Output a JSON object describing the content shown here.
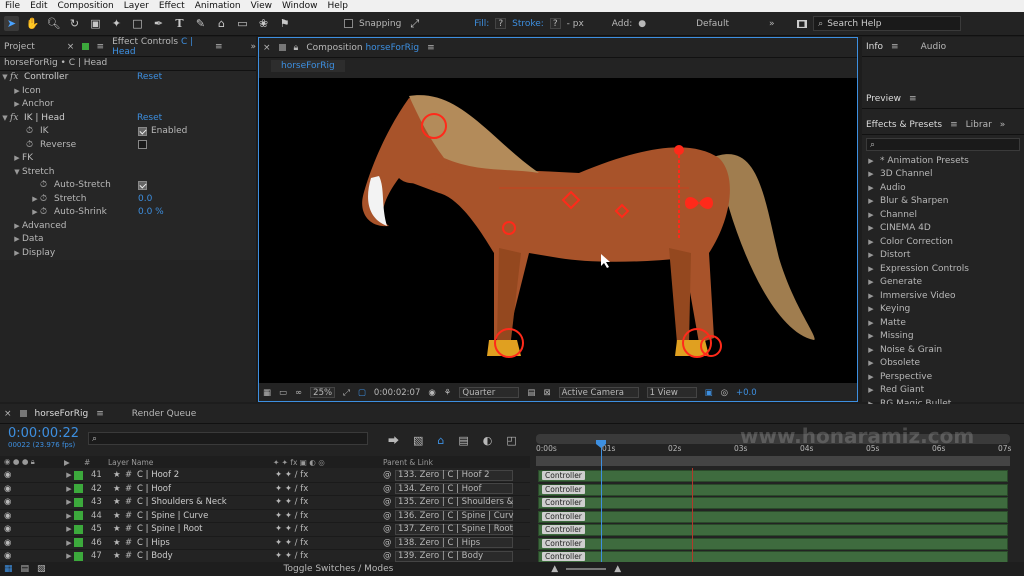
{
  "menu": [
    "File",
    "Edit",
    "Composition",
    "Layer",
    "Effect",
    "Animation",
    "View",
    "Window",
    "Help"
  ],
  "toolbar": {
    "snapping": "Snapping",
    "fill": "Fill:",
    "fill_val": "?",
    "stroke": "Stroke:",
    "stroke_val": "?",
    "px": "- px",
    "add": "Add:",
    "workspace": "Default",
    "search": "Search Help"
  },
  "project_tab": "Project",
  "effect_controls_tab": "Effect Controls",
  "effect_controls_layer": "C | Head",
  "ec_title": "horseForRig • C | Head",
  "ec": {
    "controller": "Controller",
    "reset": "Reset",
    "icon": "Icon",
    "anchor": "Anchor",
    "ik_head": "IK | Head",
    "ik": "IK",
    "enabled": "Enabled",
    "reverse": "Reverse",
    "fk": "FK",
    "stretch_grp": "Stretch",
    "auto_stretch": "Auto-Stretch",
    "stretch": "Stretch",
    "stretch_val": "0.0",
    "auto_shrink": "Auto-Shrink",
    "auto_shrink_val": "0.0 %",
    "advanced": "Advanced",
    "data": "Data",
    "display": "Display"
  },
  "comp": {
    "tab_prefix": "Composition",
    "name": "horseForRig",
    "subtab": "horseForRig",
    "zoom": "25%",
    "time": "0:00:02:07",
    "resolution": "Quarter",
    "camera": "Active Camera",
    "views": "1 View",
    "plus": "+0.0"
  },
  "right": {
    "info": "Info",
    "audio": "Audio",
    "preview": "Preview",
    "effects": "Effects & Presets",
    "libraries": "Librar",
    "effects_list": [
      "* Animation Presets",
      "3D Channel",
      "Audio",
      "Blur & Sharpen",
      "Channel",
      "CINEMA 4D",
      "Color Correction",
      "Distort",
      "Expression Controls",
      "Generate",
      "Immersive Video",
      "Keying",
      "Matte",
      "Missing",
      "Noise & Grain",
      "Obsolete",
      "Perspective",
      "Red Giant",
      "RG Magic Bullet"
    ]
  },
  "timeline": {
    "tab": "horseForRig",
    "render_queue": "Render Queue",
    "timecode": "0:00:00:22",
    "fps": "00022 (23.976 fps)",
    "col_layer": "Layer Name",
    "col_parent": "Parent & Link",
    "toggle": "Toggle Switches / Modes",
    "ruler": [
      "0:00s",
      "01s",
      "02s",
      "03s",
      "04s",
      "05s",
      "06s",
      "07s"
    ],
    "layers": [
      {
        "num": "41",
        "name": "C | Hoof 2",
        "parent": "133. Zero | C | Hoof 2"
      },
      {
        "num": "42",
        "name": "C | Hoof",
        "parent": "134. Zero | C | Hoof"
      },
      {
        "num": "43",
        "name": "C | Shoulders & Neck",
        "parent": "135. Zero | C | Shoulders &"
      },
      {
        "num": "44",
        "name": "C | Spine | Curve",
        "parent": "136. Zero | C | Spine | Curv"
      },
      {
        "num": "45",
        "name": "C | Spine | Root",
        "parent": "137. Zero | C | Spine | Root"
      },
      {
        "num": "46",
        "name": "C | Hips",
        "parent": "138. Zero | C | Hips"
      },
      {
        "num": "47",
        "name": "C | Body",
        "parent": "139. Zero | C | Body"
      }
    ],
    "bar_label": "Controller"
  },
  "watermark": "www.honaramiz.com",
  "colors": {
    "accent": "#3d8fe0",
    "layer_label": "#3ca93c",
    "bar": "#3e6b3e",
    "horse": "#a8532a",
    "mane": "#b38b5a",
    "rig": "#ff2a1a"
  }
}
